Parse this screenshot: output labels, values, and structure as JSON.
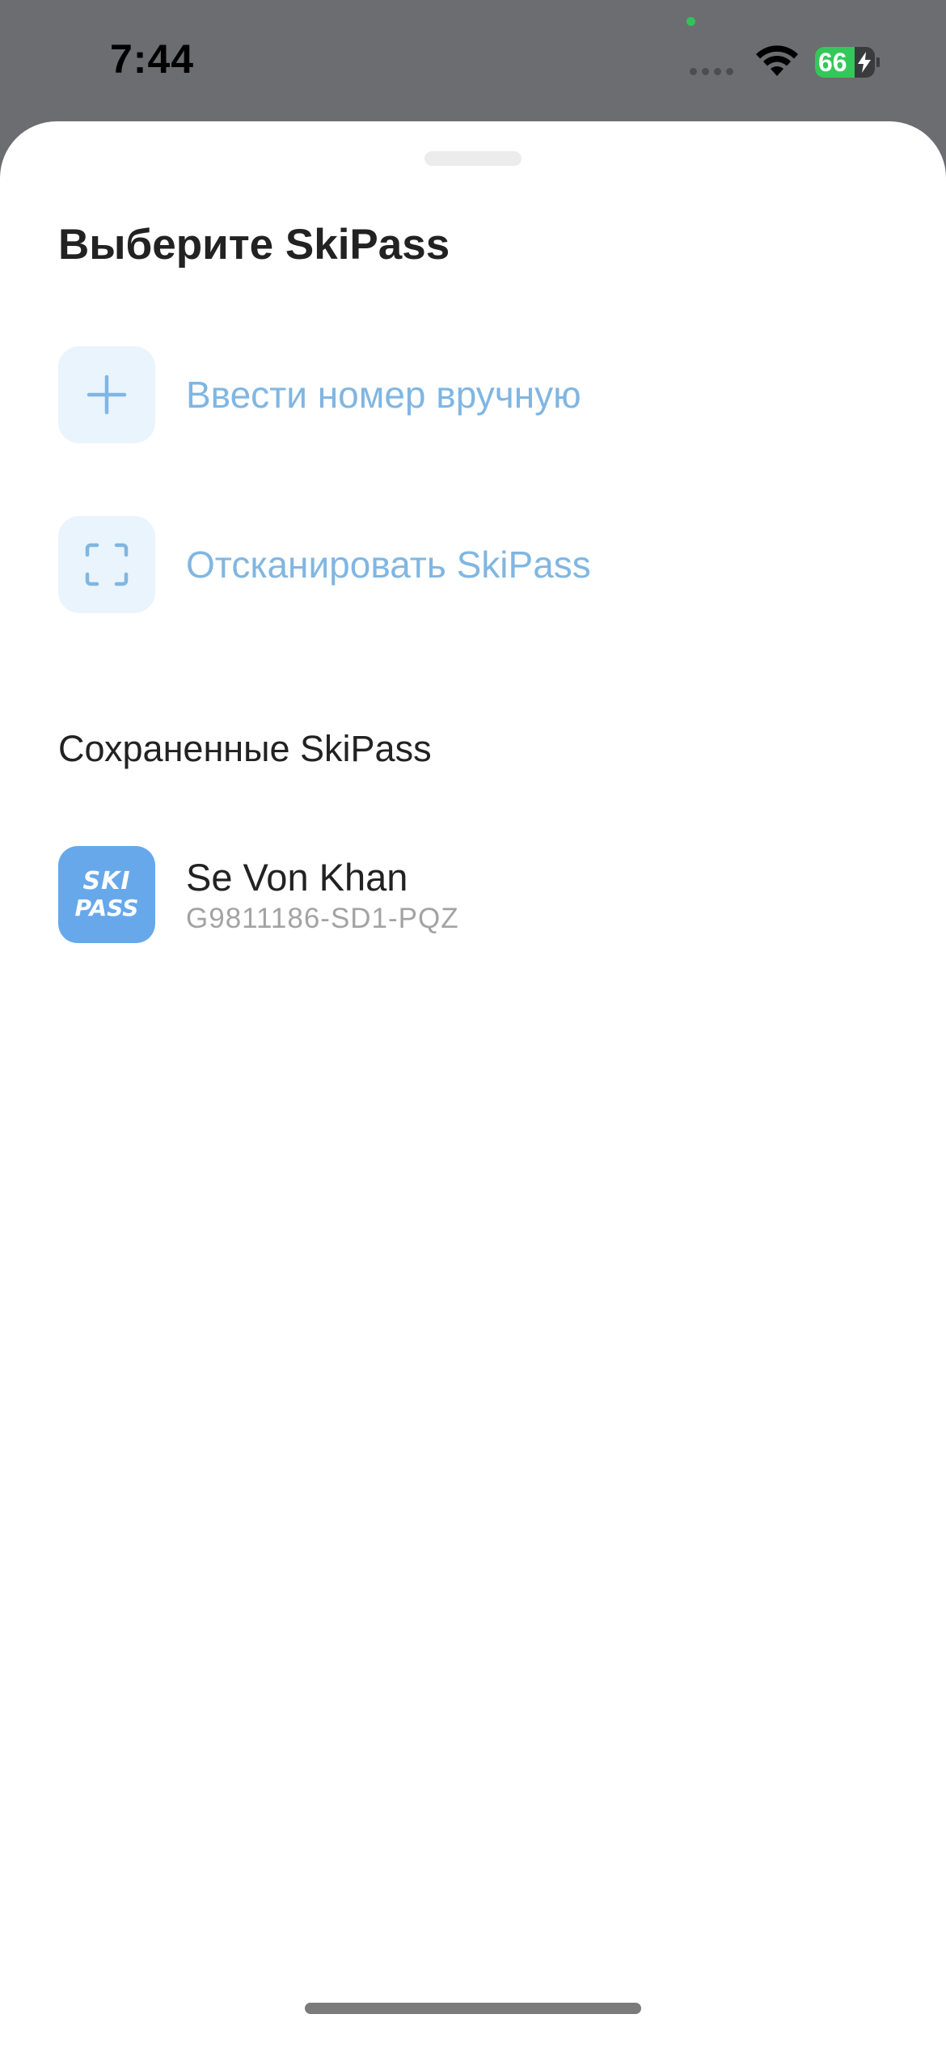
{
  "status_bar": {
    "time": "7:44",
    "battery_level": "66",
    "battery_fraction": 0.66,
    "charging": true
  },
  "sheet": {
    "title": "Выберите SkiPass",
    "actions": [
      {
        "label": "Ввести номер вручную",
        "icon": "plus-icon"
      },
      {
        "label": "Отсканировать SkiPass",
        "icon": "scan-frame-icon"
      }
    ],
    "saved_section_title": "Сохраненные SkiPass",
    "saved_passes": [
      {
        "name": "Se Von Khan",
        "code": "G9811186-SD1-PQZ",
        "logo_line1": "SKI",
        "logo_line2": "PASS"
      }
    ]
  },
  "colors": {
    "accent_text": "#80b6e2",
    "icon_bg": "#e9f4fd",
    "logo_bg": "#67a8ea",
    "battery_green": "#34c759"
  }
}
